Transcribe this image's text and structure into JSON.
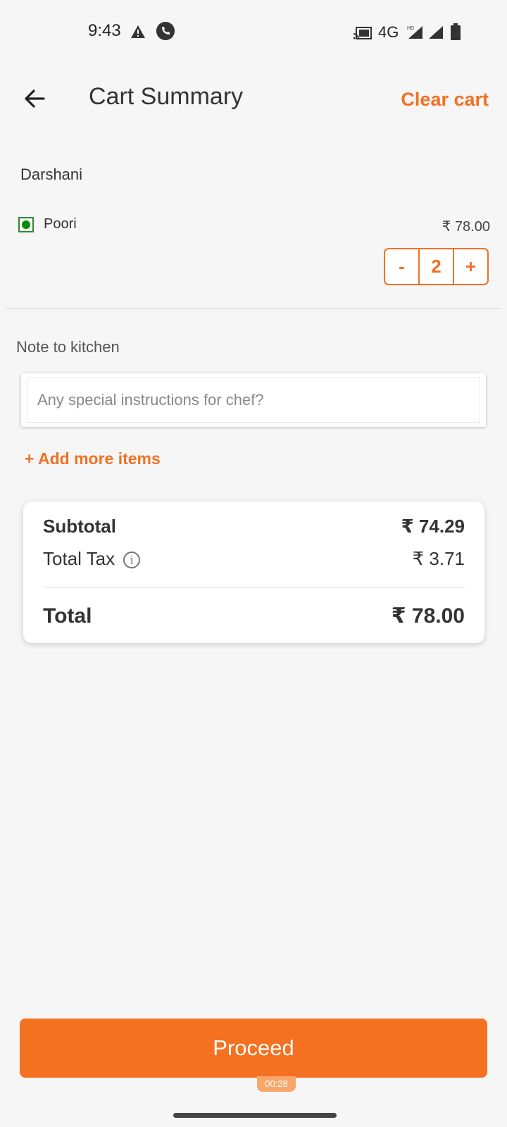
{
  "status_bar": {
    "time": "9:43",
    "network": "4G",
    "icons": [
      "warning-icon",
      "call-icon",
      "cast-icon",
      "hd-signal-icon",
      "signal-icon",
      "battery-icon"
    ]
  },
  "header": {
    "back_icon": "arrow-left-icon",
    "title": "Cart Summary",
    "clear_cart": "Clear cart"
  },
  "restaurant": {
    "name": "Darshani"
  },
  "cart_items": [
    {
      "veg_icon": "veg-indicator-icon",
      "name": "Poori",
      "price": "₹ 78.00",
      "quantity": "2",
      "decrement_label": "-",
      "increment_label": "+"
    }
  ],
  "note": {
    "label": "Note to kitchen",
    "placeholder": "Any special instructions for chef?",
    "value": ""
  },
  "add_more": "+ Add more items",
  "bill": {
    "subtotal_label": "Subtotal",
    "subtotal_value": "₹ 74.29",
    "tax_label": "Total Tax",
    "tax_value": "₹ 3.71",
    "total_label": "Total",
    "total_value": "₹ 78.00"
  },
  "footer": {
    "proceed_label": "Proceed",
    "timer": "00:28"
  },
  "colors": {
    "accent": "#f07122",
    "veg_green": "#0a8a0a",
    "background": "#f6f6f6"
  }
}
